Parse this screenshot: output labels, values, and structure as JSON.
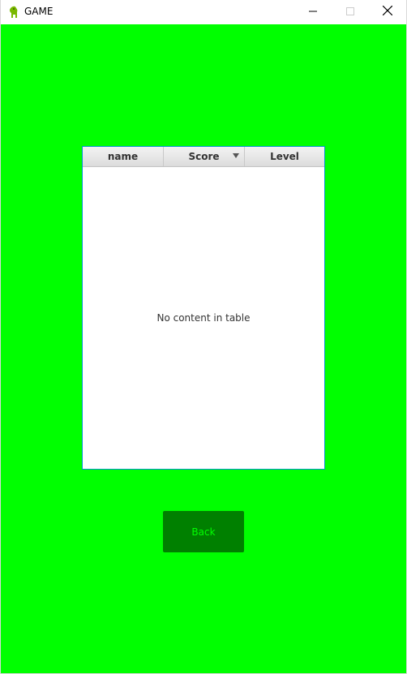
{
  "window": {
    "title": "GAME",
    "icon": "app-icon",
    "controls": [
      "minimize-icon",
      "maximize-icon",
      "close-icon"
    ]
  },
  "colors": {
    "background": "#00ff00",
    "table_border": "#0096c9",
    "button_bg": "#008000",
    "button_text": "#00ff00"
  },
  "table": {
    "columns": [
      {
        "label": "name"
      },
      {
        "label": "Score",
        "sort": "descending"
      },
      {
        "label": "Level"
      }
    ],
    "rows": [],
    "placeholder": "No content in table"
  },
  "buttons": {
    "back_label": "Back"
  }
}
